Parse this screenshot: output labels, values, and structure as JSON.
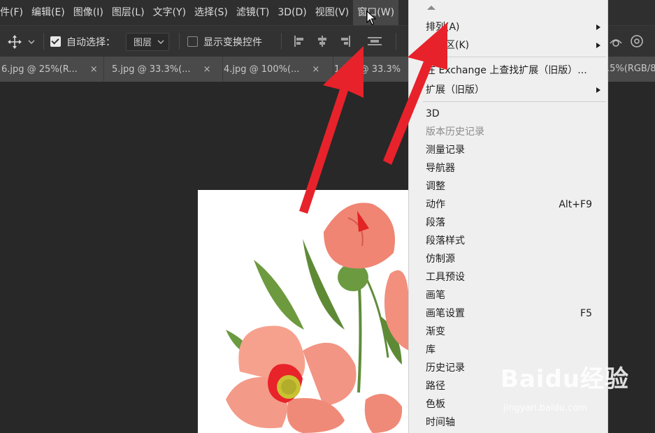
{
  "menubar": {
    "items": [
      {
        "label": "件(F)"
      },
      {
        "label": "编辑(E)"
      },
      {
        "label": "图像(I)"
      },
      {
        "label": "图层(L)"
      },
      {
        "label": "文字(Y)"
      },
      {
        "label": "选择(S)"
      },
      {
        "label": "滤镜(T)"
      },
      {
        "label": "3D(D)"
      },
      {
        "label": "视图(V)"
      },
      {
        "label": "窗口(W)",
        "active": true
      }
    ]
  },
  "options_bar": {
    "auto_select_label": "自动选择：",
    "auto_select_checked": true,
    "auto_select_target": "图层",
    "show_transform_label": "显示变换控件",
    "show_transform_checked": false
  },
  "tabs": [
    {
      "label": "6.jpg @ 25%(R..."
    },
    {
      "label": "5.jpg @ 33.3%(..."
    },
    {
      "label": "4.jpg @ 100%(..."
    },
    {
      "label": "1.jpg @ 33.3%"
    }
  ],
  "tab_right_fragment": ".5%(RGB/8",
  "window_menu": {
    "items": [
      {
        "label": "排列(A)",
        "submenu": true
      },
      {
        "label": "工作区(K)",
        "submenu": true
      },
      {
        "separator": true
      },
      {
        "label": "在 Exchange 上查找扩展（旧版）..."
      },
      {
        "label": "扩展（旧版）",
        "submenu": true
      },
      {
        "separator": true
      },
      {
        "label": "3D"
      },
      {
        "label": "版本历史记录",
        "disabled": true
      },
      {
        "label": "测量记录"
      },
      {
        "label": "导航器"
      },
      {
        "label": "调整"
      },
      {
        "label": "动作",
        "shortcut": "Alt+F9"
      },
      {
        "label": "段落"
      },
      {
        "label": "段落样式"
      },
      {
        "label": "仿制源"
      },
      {
        "label": "工具预设"
      },
      {
        "label": "画笔"
      },
      {
        "label": "画笔设置",
        "shortcut": "F5"
      },
      {
        "label": "渐变"
      },
      {
        "label": "库"
      },
      {
        "label": "历史记录"
      },
      {
        "label": "路径"
      },
      {
        "label": "色板"
      },
      {
        "label": "时间轴"
      }
    ]
  },
  "watermark": {
    "logo": "Baidu经验",
    "url": "jingyan.baidu.com"
  },
  "colors": {
    "menubar": "#2f2f2f",
    "menu_bg": "#efefef",
    "annotation_arrow": "#e8222b"
  }
}
